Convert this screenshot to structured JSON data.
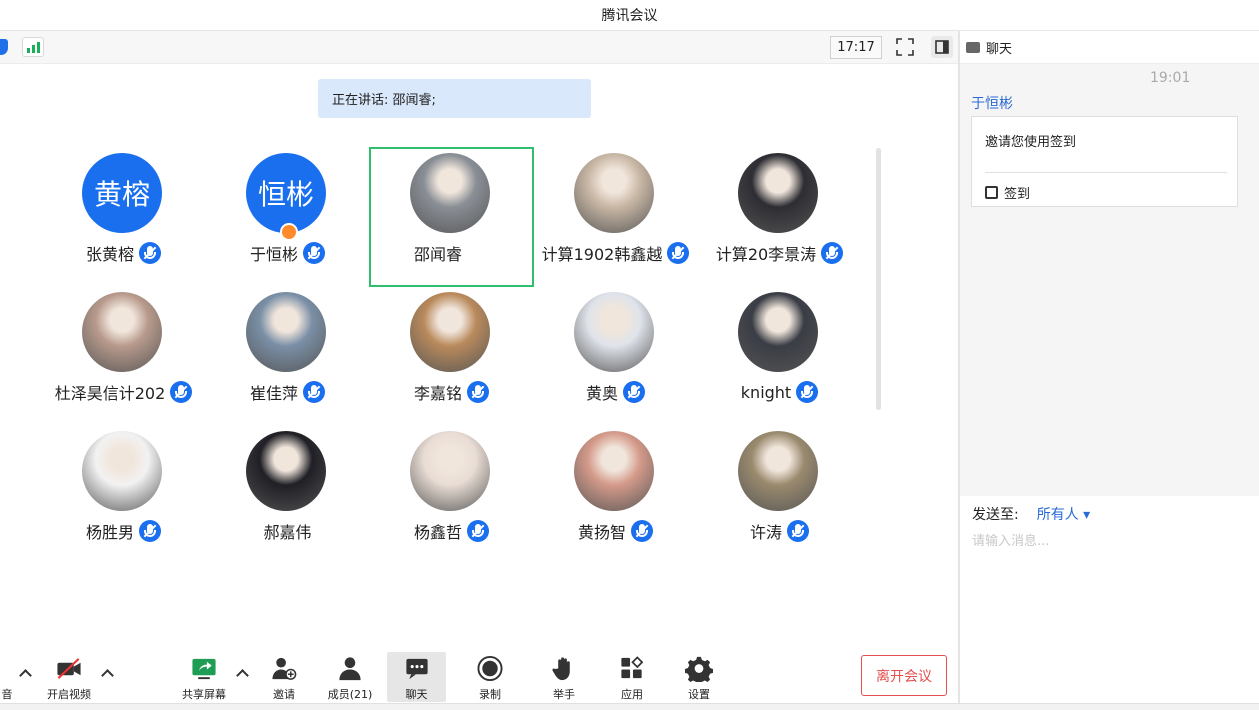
{
  "window": {
    "title": "腾讯会议"
  },
  "topbar": {
    "time": "17:17"
  },
  "speaking": {
    "text": "正在讲话: 邵闻睿;"
  },
  "participants": [
    {
      "name": "张黄榕",
      "avatar_text": "黄榕",
      "mic": "on"
    },
    {
      "name": "于恒彬",
      "avatar_text": "恒彬",
      "mic": "on",
      "host": true
    },
    {
      "name": "邵闻睿",
      "mic": "speaking",
      "active": true
    },
    {
      "name": "计算1902韩鑫越",
      "mic": "on"
    },
    {
      "name": "计算20李景涛",
      "mic": "on"
    },
    {
      "name": "杜泽昊信计202",
      "mic": "on"
    },
    {
      "name": "崔佳萍",
      "mic": "on"
    },
    {
      "name": "李嘉铭",
      "mic": "on"
    },
    {
      "name": "黄奥",
      "mic": "on"
    },
    {
      "name": "knight",
      "mic": "on"
    },
    {
      "name": "杨胜男",
      "mic": "on"
    },
    {
      "name": "郝嘉伟",
      "mic": "none"
    },
    {
      "name": "杨鑫哲",
      "mic": "on"
    },
    {
      "name": "黄扬智",
      "mic": "on"
    },
    {
      "name": "许涛",
      "mic": "on"
    }
  ],
  "toolbar": {
    "audio_label": "音",
    "video_label": "开启视频",
    "share_label": "共享屏幕",
    "invite_label": "邀请",
    "members_label": "成员(21)",
    "chat_label": "聊天",
    "record_label": "录制",
    "raise_label": "举手",
    "apps_label": "应用",
    "settings_label": "设置",
    "leave_label": "离开会议"
  },
  "chat": {
    "header": "聊天",
    "time": "19:01",
    "sender": "于恒彬",
    "message": "邀请您使用签到",
    "signin_label": "签到",
    "send_to_label": "发送至:",
    "send_target": "所有人 ▾",
    "input_placeholder": "请输入消息..."
  },
  "colors": {
    "accent": "#1a6fee",
    "speaking_ring": "#2fbd6e",
    "leave": "#e35050"
  }
}
